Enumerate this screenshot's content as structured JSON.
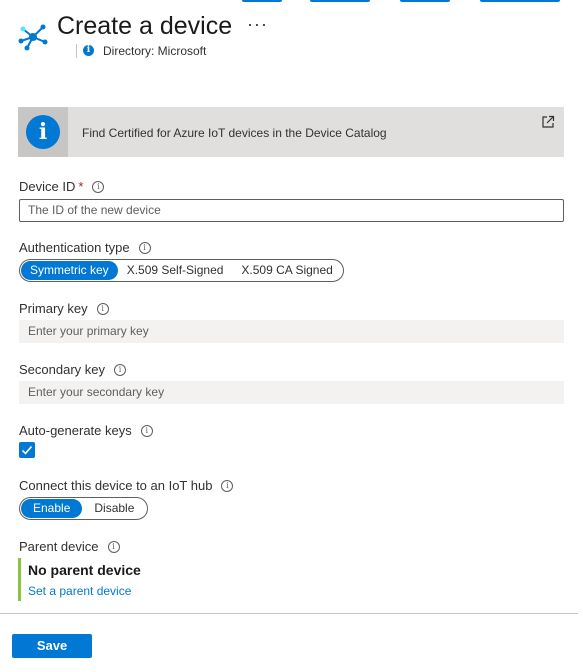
{
  "header": {
    "title": "Create a device",
    "more_label": "···",
    "directory": "Directory: Microsoft"
  },
  "banner": {
    "text": "Find Certified for Azure IoT devices in the Device Catalog",
    "info_glyph": "i",
    "icon": "external-link-icon"
  },
  "device_id": {
    "label": "Device ID",
    "required_mark": "*",
    "placeholder": "The ID of the new device"
  },
  "auth_type": {
    "label": "Authentication type",
    "options": [
      "Symmetric key",
      "X.509 Self-Signed",
      "X.509 CA Signed"
    ],
    "selected": "Symmetric key"
  },
  "primary_key": {
    "label": "Primary key",
    "placeholder": "Enter your primary key"
  },
  "secondary_key": {
    "label": "Secondary key",
    "placeholder": "Enter your secondary key"
  },
  "auto_generate": {
    "label": "Auto-generate keys",
    "checked": true
  },
  "connect_hub": {
    "label": "Connect this device to an IoT hub",
    "options": [
      "Enable",
      "Disable"
    ],
    "selected": "Enable"
  },
  "parent_device": {
    "label": "Parent device",
    "value": "No parent device",
    "link": "Set a parent device"
  },
  "footer": {
    "save_label": "Save"
  },
  "colors": {
    "accent": "#0078d4",
    "parent_bar": "#8cc43f",
    "required": "#a4262c"
  }
}
